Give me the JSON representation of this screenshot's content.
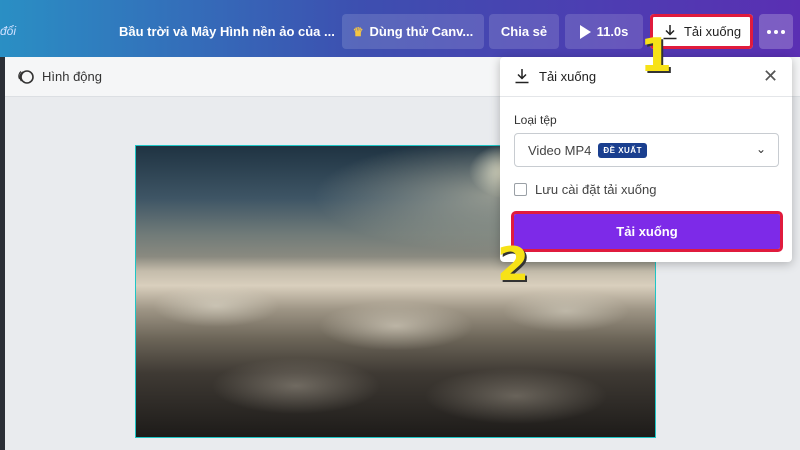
{
  "topbar": {
    "left_text": "đổi",
    "doc_title": "Bầu trời và Mây Hình nền ảo của ...",
    "try_label": "Dùng thử Canv...",
    "share_label": "Chia sẻ",
    "play_duration": "11.0s",
    "download_label": "Tải xuống"
  },
  "subbar": {
    "animate_label": "Hình động"
  },
  "panel": {
    "title": "Tải xuống",
    "filetype_label": "Loại tệp",
    "filetype_value": "Video MP4",
    "badge": "ĐỀ XUẤT",
    "save_settings_label": "Lưu cài đặt tải xuống",
    "save_settings_checked": false,
    "download_button": "Tải xuống"
  },
  "annotations": {
    "step1": "1",
    "step2": "2"
  },
  "colors": {
    "accent_purple": "#7d2ae8",
    "highlight_red": "#e01b3d",
    "step_yellow": "#f7e217",
    "badge_blue": "#1a3f8f"
  },
  "icons": [
    "crown-icon",
    "play-icon",
    "download-icon",
    "more-icon",
    "animate-icon",
    "close-icon",
    "chevron-down-icon",
    "collapse-left-icon"
  ]
}
